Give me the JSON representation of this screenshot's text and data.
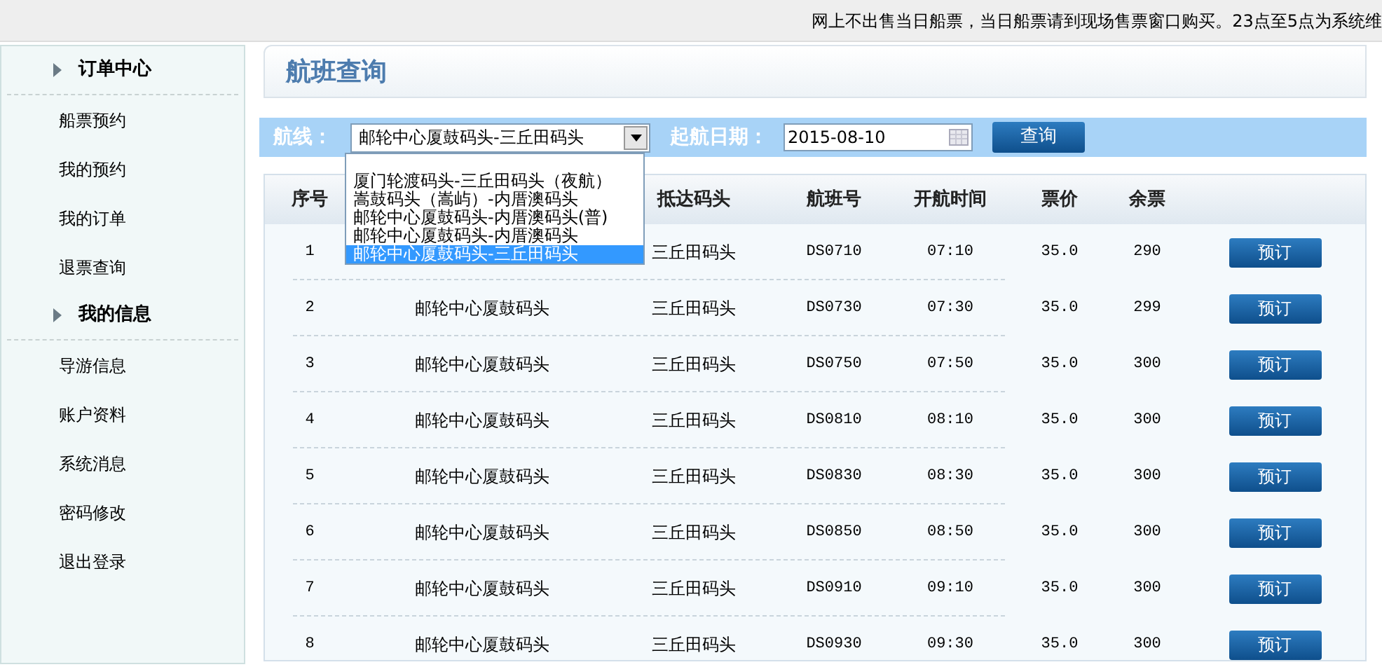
{
  "notice": "网上不出售当日船票，当日船票请到现场售票窗口购买。23点至5点为系统维",
  "sidebar": {
    "groups": [
      {
        "title": "订单中心",
        "items": [
          {
            "label": "船票预约"
          },
          {
            "label": "我的预约"
          },
          {
            "label": "我的订单"
          },
          {
            "label": "退票查询"
          }
        ]
      },
      {
        "title": "我的信息",
        "items": [
          {
            "label": "导游信息"
          },
          {
            "label": "账户资料"
          },
          {
            "label": "系统消息"
          },
          {
            "label": "密码修改"
          },
          {
            "label": "退出登录"
          }
        ]
      }
    ]
  },
  "page_title": "航班查询",
  "search": {
    "route_label": "航线：",
    "route_value": "邮轮中心厦鼓码头-三丘田码头",
    "date_label": "起航日期：",
    "date_value": "2015-08-10",
    "button": "查询",
    "route_options": [
      {
        "label": "厦门轮渡码头-三丘田码头（夜航）",
        "selected": false
      },
      {
        "label": "嵩鼓码头（嵩屿）-内厝澳码头",
        "selected": false
      },
      {
        "label": "邮轮中心厦鼓码头-内厝澳码头(普)",
        "selected": false
      },
      {
        "label": "邮轮中心厦鼓码头-内厝澳码头",
        "selected": false
      },
      {
        "label": "邮轮中心厦鼓码头-三丘田码头",
        "selected": true
      }
    ]
  },
  "table": {
    "columns": [
      {
        "label": "序号"
      },
      {
        "label": "抵达码头"
      },
      {
        "label": "航班号"
      },
      {
        "label": "开航时间"
      },
      {
        "label": "票价"
      },
      {
        "label": "余票"
      }
    ],
    "rows": [
      {
        "no": "1",
        "arrival": "三丘田码头",
        "flight": "DS0710",
        "time": "07:10",
        "price": "35.0",
        "remaining": "290",
        "button": "预订"
      },
      {
        "no": "2",
        "departure": "邮轮中心厦鼓码头",
        "arrival": "三丘田码头",
        "flight": "DS0730",
        "time": "07:30",
        "price": "35.0",
        "remaining": "299",
        "button": "预订"
      },
      {
        "no": "3",
        "departure": "邮轮中心厦鼓码头",
        "arrival": "三丘田码头",
        "flight": "DS0750",
        "time": "07:50",
        "price": "35.0",
        "remaining": "300",
        "button": "预订"
      },
      {
        "no": "4",
        "departure": "邮轮中心厦鼓码头",
        "arrival": "三丘田码头",
        "flight": "DS0810",
        "time": "08:10",
        "price": "35.0",
        "remaining": "300",
        "button": "预订"
      },
      {
        "no": "5",
        "departure": "邮轮中心厦鼓码头",
        "arrival": "三丘田码头",
        "flight": "DS0830",
        "time": "08:30",
        "price": "35.0",
        "remaining": "300",
        "button": "预订"
      },
      {
        "no": "6",
        "departure": "邮轮中心厦鼓码头",
        "arrival": "三丘田码头",
        "flight": "DS0850",
        "time": "08:50",
        "price": "35.0",
        "remaining": "300",
        "button": "预订"
      },
      {
        "no": "7",
        "departure": "邮轮中心厦鼓码头",
        "arrival": "三丘田码头",
        "flight": "DS0910",
        "time": "09:10",
        "price": "35.0",
        "remaining": "300",
        "button": "预订"
      },
      {
        "no": "8",
        "departure": "邮轮中心厦鼓码头",
        "arrival": "三丘田码头",
        "flight": "DS0930",
        "time": "09:30",
        "price": "35.0",
        "remaining": "300",
        "button": "预订"
      }
    ]
  }
}
